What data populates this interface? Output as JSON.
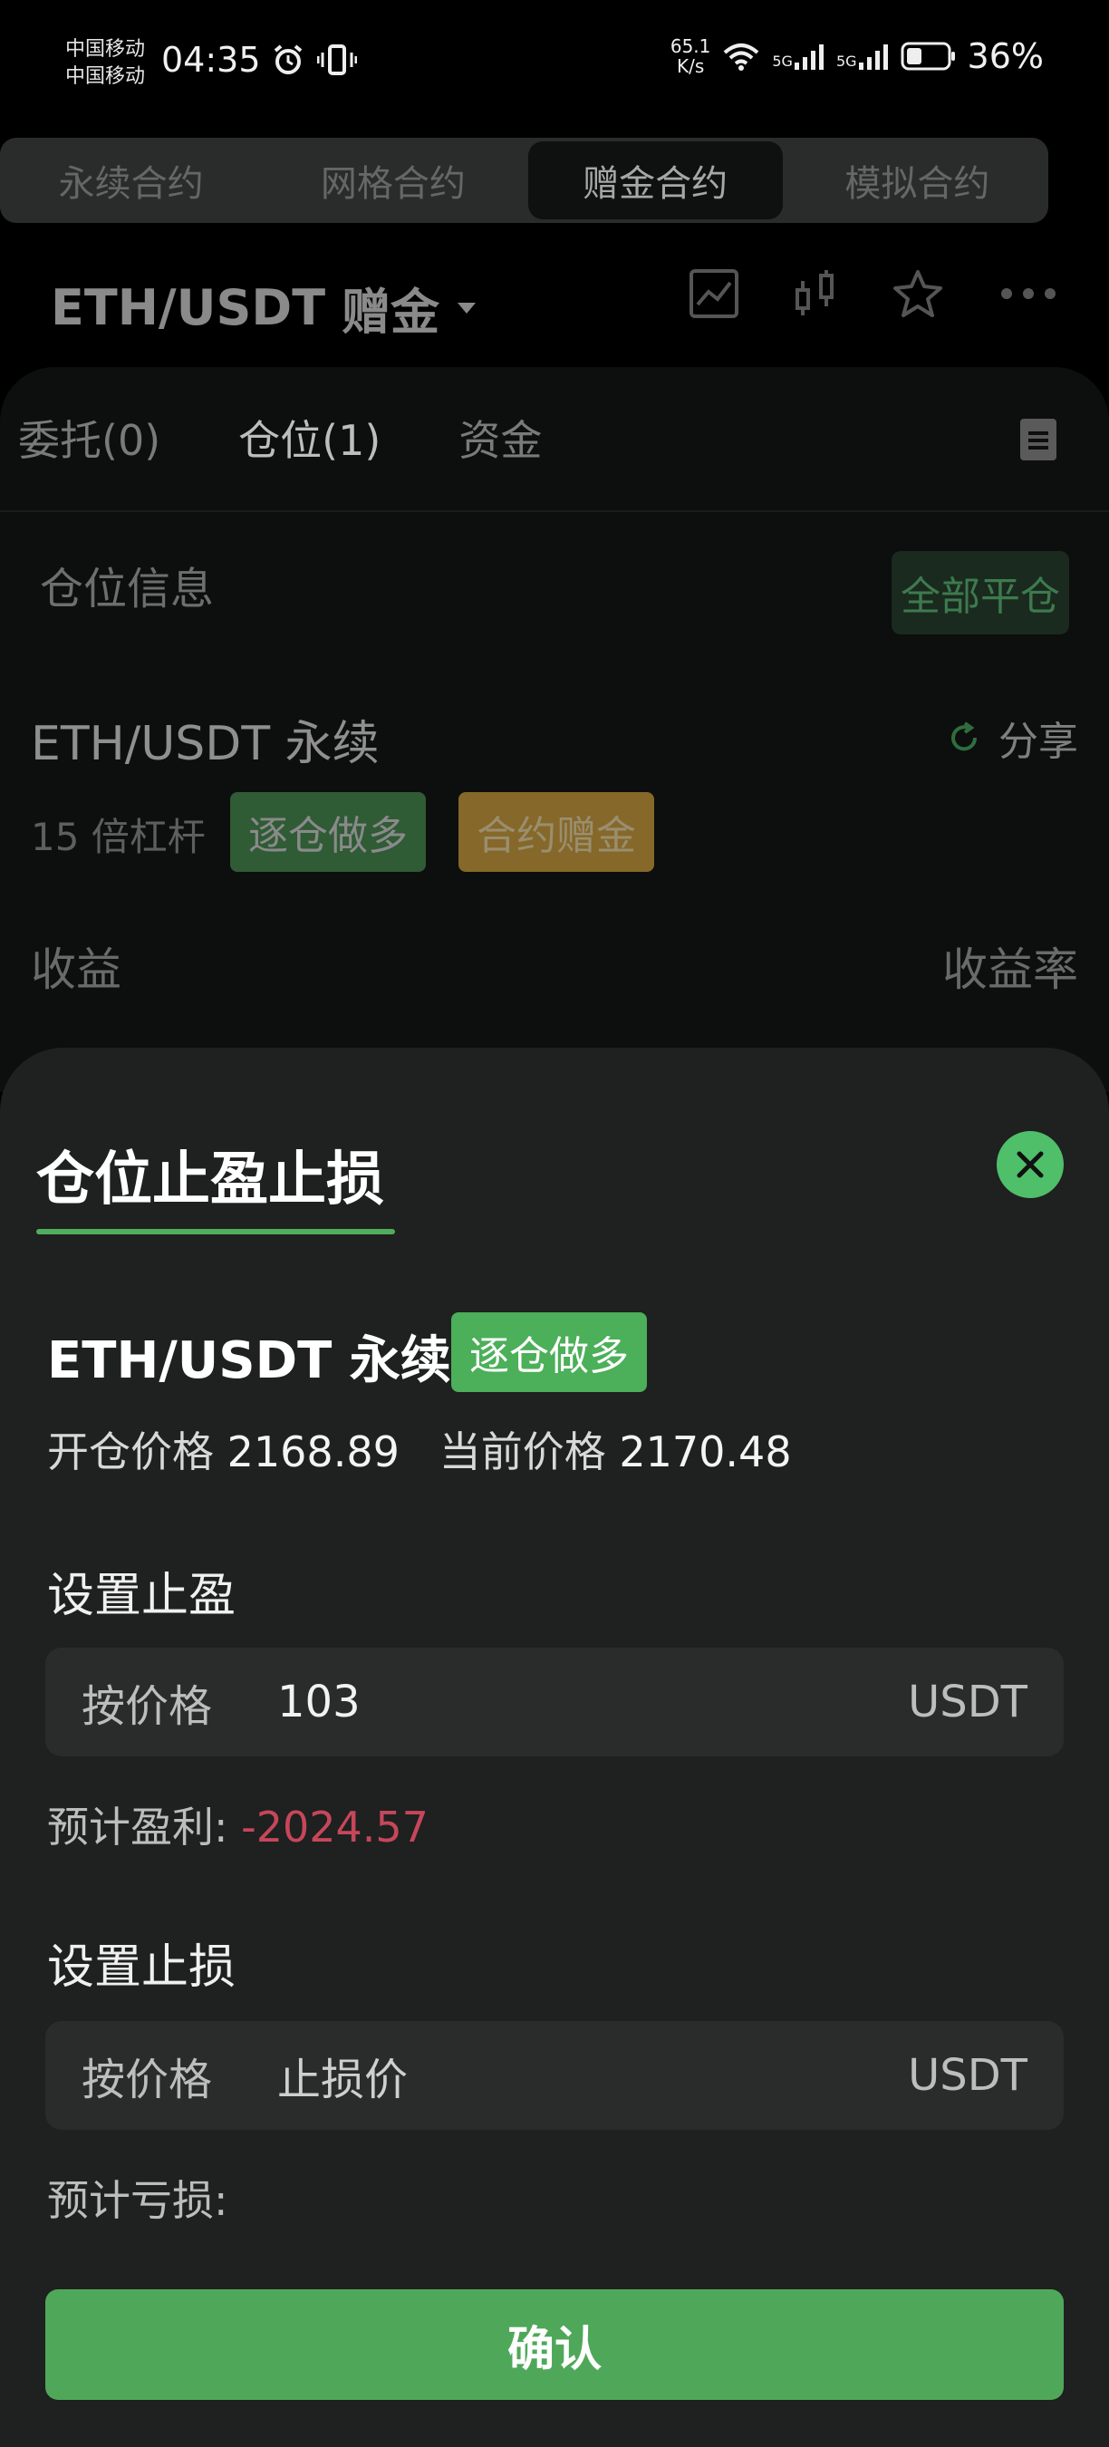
{
  "status_bar": {
    "carrier_1": "中国移动",
    "carrier_2": "中国移动",
    "time": "04:35",
    "net_speed_value": "65.1",
    "net_speed_unit": "K/s",
    "signal_1": "5G",
    "signal_2": "5G",
    "battery_percent": "36%"
  },
  "contract_tabs": [
    {
      "label": "永续合约",
      "active": false
    },
    {
      "label": "网格合约",
      "active": false
    },
    {
      "label": "赠金合约",
      "active": true
    },
    {
      "label": "模拟合约",
      "active": false
    }
  ],
  "header": {
    "pair": "ETH/USDT",
    "mode": "赠金",
    "icons": [
      "chart-icon",
      "candlestick-icon",
      "star-icon",
      "more-icon"
    ]
  },
  "sub_tabs": {
    "orders": "委托(0)",
    "positions": "仓位(1)",
    "funds": "资金"
  },
  "position_card": {
    "section_title": "仓位信息",
    "close_all": "全部平仓",
    "pair": "ETH/USDT 永续",
    "share": "分享",
    "leverage": "15 倍杠杆",
    "badge_margin": "逐仓做多",
    "badge_bonus": "合约赠金",
    "pnl_label": "收益",
    "pnl_rate_label": "收益率"
  },
  "sheet": {
    "title": "仓位止盈止损",
    "pair": "ETH/USDT 永续",
    "badge": "逐仓做多",
    "open_price_label": "开仓价格",
    "open_price": "2168.89",
    "current_price_label": "当前价格",
    "current_price": "2170.48",
    "take_profit": {
      "section_label": "设置止盈",
      "field_label": "按价格",
      "value": "103",
      "unit": "USDT",
      "est_label": "预计盈利:",
      "est_value": "-2024.57"
    },
    "stop_loss": {
      "section_label": "设置止损",
      "field_label": "按价格",
      "placeholder": "止损价",
      "unit": "USDT",
      "est_label": "预计亏损:"
    },
    "confirm": "确认"
  },
  "colors": {
    "accent_green": "#4fa859",
    "loss_red": "#c6475a"
  }
}
